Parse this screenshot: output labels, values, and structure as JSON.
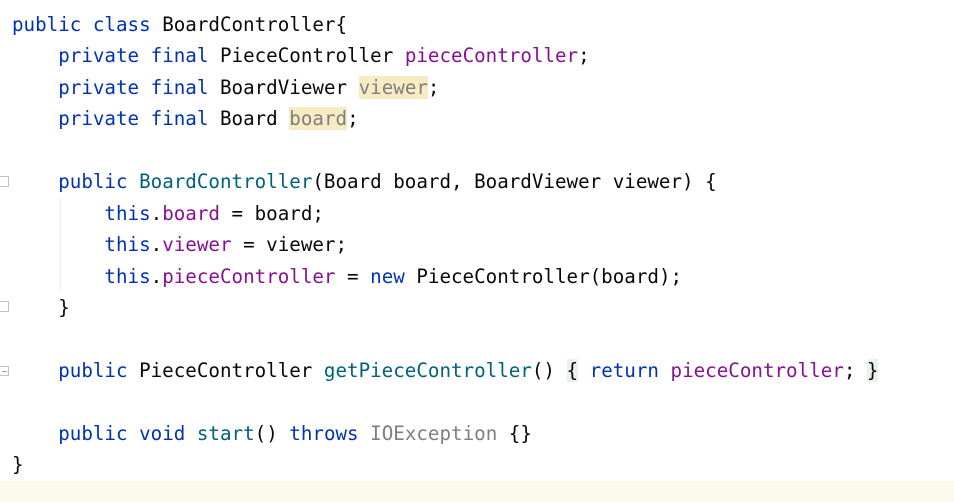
{
  "editor": {
    "lines": [
      {
        "tokens": [
          {
            "t": "public",
            "c": "kw"
          },
          {
            "t": " "
          },
          {
            "t": "class",
            "c": "kw"
          },
          {
            "t": " BoardController{"
          }
        ]
      },
      {
        "tokens": [
          {
            "t": "    "
          },
          {
            "t": "private",
            "c": "kw"
          },
          {
            "t": " "
          },
          {
            "t": "final",
            "c": "kw"
          },
          {
            "t": " PieceController "
          },
          {
            "t": "pieceController",
            "c": "fld"
          },
          {
            "t": ";"
          }
        ]
      },
      {
        "tokens": [
          {
            "t": "    "
          },
          {
            "t": "private",
            "c": "kw"
          },
          {
            "t": " "
          },
          {
            "t": "final",
            "c": "kw"
          },
          {
            "t": " BoardViewer "
          },
          {
            "t": "viewer",
            "c": "grey hl"
          },
          {
            "t": ";"
          }
        ]
      },
      {
        "tokens": [
          {
            "t": "    "
          },
          {
            "t": "private",
            "c": "kw"
          },
          {
            "t": " "
          },
          {
            "t": "final",
            "c": "kw"
          },
          {
            "t": " Board "
          },
          {
            "t": "board",
            "c": "grey hl"
          },
          {
            "t": ";"
          }
        ]
      },
      {
        "tokens": []
      },
      {
        "tokens": [
          {
            "t": "    "
          },
          {
            "t": "public",
            "c": "kw"
          },
          {
            "t": " "
          },
          {
            "t": "BoardController",
            "c": "mth"
          },
          {
            "t": "(Board board, BoardViewer viewer) {"
          }
        ]
      },
      {
        "tokens": [
          {
            "t": "        "
          },
          {
            "t": "this",
            "c": "kw"
          },
          {
            "t": "."
          },
          {
            "t": "board",
            "c": "fld"
          },
          {
            "t": " = board;"
          }
        ]
      },
      {
        "tokens": [
          {
            "t": "        "
          },
          {
            "t": "this",
            "c": "kw"
          },
          {
            "t": "."
          },
          {
            "t": "viewer",
            "c": "fld"
          },
          {
            "t": " = viewer;"
          }
        ]
      },
      {
        "tokens": [
          {
            "t": "        "
          },
          {
            "t": "this",
            "c": "kw"
          },
          {
            "t": "."
          },
          {
            "t": "pieceController",
            "c": "fld"
          },
          {
            "t": " = "
          },
          {
            "t": "new",
            "c": "kw"
          },
          {
            "t": " PieceController(board);"
          }
        ]
      },
      {
        "tokens": [
          {
            "t": "    }"
          }
        ]
      },
      {
        "tokens": []
      },
      {
        "tokens": [
          {
            "t": "    "
          },
          {
            "t": "public",
            "c": "kw"
          },
          {
            "t": " PieceController "
          },
          {
            "t": "getPieceController",
            "c": "mth"
          },
          {
            "t": "()"
          },
          {
            "t": " "
          },
          {
            "t": "{",
            "c": "fold-bg"
          },
          {
            "t": " "
          },
          {
            "t": "return",
            "c": "kw"
          },
          {
            "t": " "
          },
          {
            "t": "pieceController",
            "c": "fld"
          },
          {
            "t": "; "
          },
          {
            "t": "}",
            "c": "fold-bg"
          }
        ]
      },
      {
        "tokens": []
      },
      {
        "tokens": [
          {
            "t": "    "
          },
          {
            "t": "public",
            "c": "kw"
          },
          {
            "t": " "
          },
          {
            "t": "void",
            "c": "kw"
          },
          {
            "t": " "
          },
          {
            "t": "start",
            "c": "mth"
          },
          {
            "t": "() "
          },
          {
            "t": "throws",
            "c": "kw"
          },
          {
            "t": " "
          },
          {
            "t": "IOException",
            "c": "grey"
          },
          {
            "t": " {}"
          }
        ]
      },
      {
        "tokens": [
          {
            "t": "}"
          }
        ]
      }
    ]
  }
}
